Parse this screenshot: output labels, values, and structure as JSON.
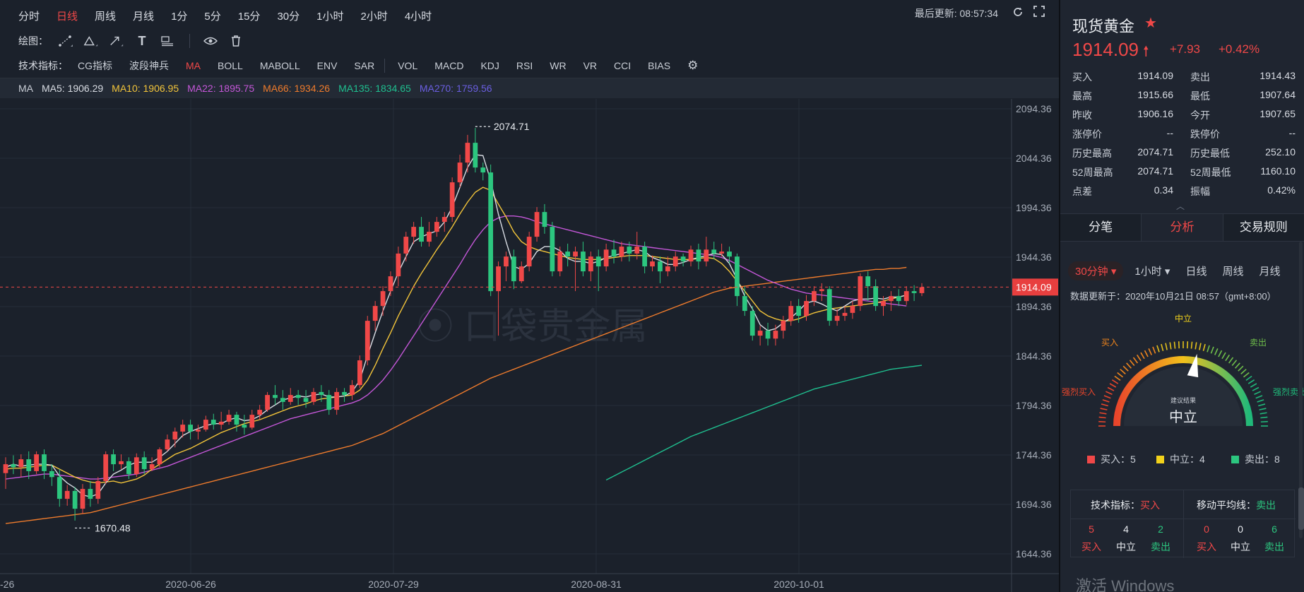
{
  "toolbar": {
    "periods": [
      {
        "label": "分时",
        "active": false
      },
      {
        "label": "日线",
        "active": true
      },
      {
        "label": "周线",
        "active": false
      },
      {
        "label": "月线",
        "active": false
      },
      {
        "label": "1分",
        "active": false
      },
      {
        "label": "5分",
        "active": false
      },
      {
        "label": "15分",
        "active": false
      },
      {
        "label": "30分",
        "active": false
      },
      {
        "label": "1小时",
        "active": false
      },
      {
        "label": "2小时",
        "active": false
      },
      {
        "label": "4小时",
        "active": false
      }
    ],
    "last_update": "最后更新: 08:57:34",
    "draw_label": "绘图：",
    "indicator_label": "技术指标：",
    "indicators_a": [
      "CG指标",
      "波段神兵",
      "MA",
      "BOLL",
      "MABOLL",
      "ENV",
      "SAR"
    ],
    "indicators_b": [
      "VOL",
      "MACD",
      "KDJ",
      "RSI",
      "WR",
      "VR",
      "CCI",
      "BIAS"
    ],
    "active_indicator": "MA"
  },
  "ma_bar": {
    "label": "MA",
    "items": [
      {
        "text": "MA5: 1906.29",
        "color": "#d8dce3"
      },
      {
        "text": "MA10: 1906.95",
        "color": "#f2c43a"
      },
      {
        "text": "MA22: 1895.75",
        "color": "#c457d8"
      },
      {
        "text": "MA66: 1934.26",
        "color": "#ee7b2c"
      },
      {
        "text": "MA135: 1834.65",
        "color": "#1fbf8f"
      },
      {
        "text": "MA270: 1759.56",
        "color": "#6a5ee0"
      }
    ]
  },
  "chart_data": {
    "type": "candlestick",
    "y_ticks": [
      "2094.36",
      "2044.36",
      "1994.36",
      "1944.36",
      "1894.36",
      "1844.36",
      "1794.36",
      "1744.36",
      "1694.36",
      "1644.36"
    ],
    "ylim": [
      1631,
      2107
    ],
    "x_ticks": [
      "-26",
      "2020-06-26",
      "2020-07-29",
      "2020-08-31",
      "2020-10-01"
    ],
    "current_price_label": "1914.09",
    "current_price": 1914.09,
    "high_annotation": "2074.71",
    "low_annotation": "1670.48",
    "colors": {
      "up": "#f04848",
      "down": "#2cc67f"
    },
    "candles": [
      [
        1726,
        1735,
        1710,
        1742
      ],
      [
        1735,
        1732,
        1725,
        1744
      ],
      [
        1732,
        1740,
        1722,
        1745
      ],
      [
        1740,
        1728,
        1720,
        1748
      ],
      [
        1728,
        1745,
        1725,
        1748
      ],
      [
        1745,
        1728,
        1720,
        1750
      ],
      [
        1728,
        1722,
        1713,
        1735
      ],
      [
        1722,
        1700,
        1692,
        1730
      ],
      [
        1700,
        1708,
        1693,
        1714
      ],
      [
        1708,
        1690,
        1678,
        1712
      ],
      [
        1690,
        1710,
        1685,
        1715
      ],
      [
        1710,
        1700,
        1692,
        1718
      ],
      [
        1700,
        1718,
        1695,
        1722
      ],
      [
        1718,
        1745,
        1715,
        1748
      ],
      [
        1745,
        1735,
        1728,
        1750
      ],
      [
        1735,
        1738,
        1730,
        1745
      ],
      [
        1738,
        1725,
        1720,
        1742
      ],
      [
        1725,
        1742,
        1722,
        1746
      ],
      [
        1742,
        1730,
        1725,
        1748
      ],
      [
        1730,
        1735,
        1728,
        1742
      ],
      [
        1735,
        1750,
        1732,
        1752
      ],
      [
        1750,
        1760,
        1748,
        1765
      ],
      [
        1760,
        1768,
        1752,
        1772
      ],
      [
        1768,
        1775,
        1762,
        1780
      ],
      [
        1775,
        1768,
        1760,
        1780
      ],
      [
        1768,
        1770,
        1760,
        1775
      ],
      [
        1770,
        1780,
        1768,
        1784
      ],
      [
        1780,
        1775,
        1770,
        1786
      ],
      [
        1775,
        1778,
        1770,
        1788
      ],
      [
        1778,
        1785,
        1775,
        1790
      ],
      [
        1785,
        1775,
        1768,
        1788
      ],
      [
        1775,
        1772,
        1765,
        1785
      ],
      [
        1772,
        1785,
        1770,
        1790
      ],
      [
        1785,
        1790,
        1780,
        1795
      ],
      [
        1790,
        1805,
        1788,
        1808
      ],
      [
        1805,
        1802,
        1795,
        1815
      ],
      [
        1802,
        1798,
        1790,
        1810
      ],
      [
        1798,
        1805,
        1795,
        1812
      ],
      [
        1805,
        1802,
        1795,
        1810
      ],
      [
        1802,
        1798,
        1792,
        1810
      ],
      [
        1798,
        1808,
        1795,
        1812
      ],
      [
        1808,
        1805,
        1798,
        1815
      ],
      [
        1805,
        1790,
        1785,
        1810
      ],
      [
        1790,
        1808,
        1785,
        1812
      ],
      [
        1808,
        1805,
        1798,
        1812
      ],
      [
        1805,
        1815,
        1800,
        1820
      ],
      [
        1815,
        1840,
        1812,
        1845
      ],
      [
        1840,
        1880,
        1835,
        1885
      ],
      [
        1880,
        1895,
        1870,
        1900
      ],
      [
        1895,
        1910,
        1885,
        1915
      ],
      [
        1910,
        1925,
        1905,
        1930
      ],
      [
        1925,
        1948,
        1915,
        1955
      ],
      [
        1948,
        1965,
        1940,
        1970
      ],
      [
        1965,
        1975,
        1958,
        1980
      ],
      [
        1975,
        1960,
        1955,
        1985
      ],
      [
        1960,
        1970,
        1955,
        1980
      ],
      [
        1970,
        1980,
        1965,
        1985
      ],
      [
        1980,
        1985,
        1970,
        1990
      ],
      [
        1985,
        2020,
        1980,
        2025
      ],
      [
        2020,
        2040,
        2015,
        2048
      ],
      [
        2040,
        2060,
        2030,
        2068
      ],
      [
        2060,
        2035,
        2030,
        2075
      ],
      [
        2035,
        2030,
        2022,
        2040
      ],
      [
        2030,
        1910,
        1905,
        2038
      ],
      [
        1910,
        1935,
        1865,
        1940
      ],
      [
        1935,
        1945,
        1920,
        1950
      ],
      [
        1945,
        1920,
        1912,
        1952
      ],
      [
        1920,
        1935,
        1918,
        1940
      ],
      [
        1935,
        1965,
        1930,
        1970
      ],
      [
        1965,
        1990,
        1960,
        1995
      ],
      [
        1990,
        1975,
        1968,
        1998
      ],
      [
        1975,
        1930,
        1925,
        1980
      ],
      [
        1930,
        1950,
        1925,
        1955
      ],
      [
        1950,
        1945,
        1935,
        1958
      ],
      [
        1945,
        1950,
        1910,
        1955
      ],
      [
        1950,
        1930,
        1925,
        1960
      ],
      [
        1930,
        1945,
        1920,
        1950
      ],
      [
        1945,
        1935,
        1910,
        1952
      ],
      [
        1935,
        1952,
        1930,
        1958
      ],
      [
        1952,
        1945,
        1938,
        1962
      ],
      [
        1945,
        1955,
        1940,
        1960
      ],
      [
        1955,
        1948,
        1940,
        1960
      ],
      [
        1948,
        1955,
        1942,
        1970
      ],
      [
        1955,
        1935,
        1928,
        1960
      ],
      [
        1935,
        1940,
        1930,
        1946
      ],
      [
        1940,
        1930,
        1918,
        1945
      ],
      [
        1930,
        1935,
        1925,
        1945
      ],
      [
        1935,
        1945,
        1930,
        1950
      ],
      [
        1945,
        1940,
        1935,
        1948
      ],
      [
        1940,
        1952,
        1935,
        1956
      ],
      [
        1952,
        1940,
        1932,
        1958
      ],
      [
        1940,
        1952,
        1935,
        1965
      ],
      [
        1952,
        1948,
        1942,
        1960
      ],
      [
        1948,
        1950,
        1945,
        1958
      ],
      [
        1950,
        1945,
        1938,
        1955
      ],
      [
        1945,
        1905,
        1895,
        1948
      ],
      [
        1905,
        1890,
        1885,
        1915
      ],
      [
        1890,
        1865,
        1860,
        1895
      ],
      [
        1865,
        1870,
        1855,
        1875
      ],
      [
        1870,
        1862,
        1855,
        1878
      ],
      [
        1862,
        1870,
        1855,
        1876
      ],
      [
        1870,
        1880,
        1862,
        1885
      ],
      [
        1880,
        1895,
        1875,
        1900
      ],
      [
        1895,
        1885,
        1878,
        1902
      ],
      [
        1885,
        1900,
        1880,
        1906
      ],
      [
        1900,
        1910,
        1895,
        1915
      ],
      [
        1910,
        1912,
        1900,
        1918
      ],
      [
        1912,
        1880,
        1875,
        1915
      ],
      [
        1880,
        1885,
        1875,
        1892
      ],
      [
        1885,
        1888,
        1880,
        1895
      ],
      [
        1888,
        1895,
        1882,
        1900
      ],
      [
        1895,
        1925,
        1890,
        1928
      ],
      [
        1925,
        1915,
        1900,
        1930
      ],
      [
        1915,
        1895,
        1890,
        1922
      ],
      [
        1895,
        1900,
        1885,
        1905
      ],
      [
        1900,
        1905,
        1890,
        1910
      ],
      [
        1905,
        1900,
        1895,
        1912
      ],
      [
        1900,
        1910,
        1896,
        1915
      ],
      [
        1910,
        1908,
        1900,
        1916
      ],
      [
        1908,
        1914,
        1905,
        1918
      ]
    ],
    "ma5": [
      1732,
      1735,
      1733,
      1734,
      1735,
      1735,
      1734,
      1723,
      1716,
      1711,
      1704,
      1702,
      1705,
      1716,
      1725,
      1729,
      1734,
      1737,
      1737,
      1737,
      1742,
      1748,
      1756,
      1764,
      1768,
      1771,
      1774,
      1776,
      1776,
      1780,
      1782,
      1779,
      1780,
      1784,
      1790,
      1795,
      1800,
      1802,
      1804,
      1803,
      1805,
      1806,
      1803,
      1803,
      1804,
      1808,
      1820,
      1845,
      1868,
      1890,
      1910,
      1929,
      1945,
      1960,
      1965,
      1968,
      1971,
      1980,
      1995,
      2015,
      2035,
      2048,
      2047,
      2022,
      1988,
      1960,
      1935,
      1932,
      1938,
      1950,
      1955,
      1955,
      1951,
      1943,
      1940,
      1940,
      1938,
      1940,
      1944,
      1946,
      1948,
      1950,
      1952,
      1950,
      1944,
      1941,
      1937,
      1937,
      1939,
      1942,
      1944,
      1946,
      1948,
      1947,
      1938,
      1922,
      1905,
      1892,
      1876,
      1870,
      1872,
      1878,
      1883,
      1890,
      1898,
      1900,
      1897,
      1893,
      1890,
      1895,
      1900,
      1902,
      1902,
      1903,
      1902,
      1904,
      1904,
      1906
    ],
    "ma10": [
      1730,
      1731,
      1731,
      1732,
      1733,
      1734,
      1734,
      1730,
      1726,
      1722,
      1719,
      1717,
      1716,
      1717,
      1718,
      1716,
      1718,
      1720,
      1724,
      1730,
      1735,
      1740,
      1745,
      1748,
      1751,
      1755,
      1759,
      1763,
      1767,
      1770,
      1773,
      1776,
      1778,
      1780,
      1783,
      1786,
      1789,
      1792,
      1794,
      1796,
      1799,
      1801,
      1802,
      1803,
      1804,
      1805,
      1810,
      1820,
      1835,
      1852,
      1868,
      1885,
      1900,
      1915,
      1928,
      1940,
      1952,
      1963,
      1975,
      1988,
      2000,
      2010,
      2015,
      2012,
      1998,
      1985,
      1970,
      1960,
      1955,
      1952,
      1950,
      1948,
      1946,
      1944,
      1943,
      1942,
      1942,
      1942,
      1943,
      1944,
      1945,
      1946,
      1946,
      1946,
      1945,
      1944,
      1943,
      1942,
      1942,
      1942,
      1943,
      1944,
      1943,
      1938,
      1930,
      1920,
      1910,
      1900,
      1890,
      1885,
      1882,
      1880,
      1880,
      1882,
      1885,
      1888,
      1890,
      1892,
      1893,
      1894,
      1895,
      1896,
      1897,
      1898,
      1900,
      1902,
      1904,
      1906
    ],
    "ma22": [
      1720,
      1721,
      1722,
      1723,
      1724,
      1725,
      1725,
      1724,
      1723,
      1722,
      1721,
      1720,
      1720,
      1721,
      1722,
      1723,
      1724,
      1725,
      1727,
      1729,
      1731,
      1733,
      1736,
      1739,
      1742,
      1745,
      1748,
      1751,
      1754,
      1757,
      1760,
      1763,
      1766,
      1769,
      1772,
      1775,
      1778,
      1781,
      1783,
      1785,
      1787,
      1789,
      1791,
      1793,
      1795,
      1797,
      1800,
      1805,
      1812,
      1820,
      1830,
      1841,
      1853,
      1865,
      1877,
      1889,
      1901,
      1913,
      1925,
      1937,
      1950,
      1962,
      1972,
      1980,
      1984,
      1986,
      1986,
      1985,
      1983,
      1980,
      1978,
      1976,
      1974,
      1972,
      1970,
      1968,
      1966,
      1964,
      1962,
      1960,
      1958,
      1957,
      1956,
      1955,
      1954,
      1953,
      1952,
      1951,
      1950,
      1949,
      1948,
      1947,
      1946,
      1944,
      1941,
      1937,
      1933,
      1929,
      1925,
      1921,
      1918,
      1915,
      1912,
      1910,
      1908,
      1907,
      1906,
      1905,
      1904,
      1903,
      1902,
      1901,
      1900,
      1899,
      1898,
      1897,
      1896,
      1895
    ],
    "ma66": [
      1675,
      1676,
      1677,
      1678,
      1679,
      1680,
      1681,
      1682,
      1683,
      1684,
      1685,
      1686,
      1688,
      1690,
      1692,
      1694,
      1696,
      1698,
      1700,
      1702,
      1704,
      1706,
      1708,
      1710,
      1712,
      1714,
      1716,
      1718,
      1720,
      1722,
      1724,
      1726,
      1728,
      1730,
      1732,
      1734,
      1736,
      1738,
      1740,
      1742,
      1744,
      1746,
      1748,
      1750,
      1752,
      1754,
      1757,
      1760,
      1763,
      1766,
      1770,
      1774,
      1778,
      1782,
      1786,
      1790,
      1794,
      1798,
      1802,
      1806,
      1810,
      1814,
      1818,
      1822,
      1825,
      1828,
      1831,
      1834,
      1837,
      1840,
      1843,
      1846,
      1849,
      1852,
      1855,
      1858,
      1861,
      1864,
      1867,
      1870,
      1873,
      1876,
      1879,
      1882,
      1885,
      1888,
      1891,
      1894,
      1897,
      1900,
      1903,
      1906,
      1909,
      1911,
      1913,
      1914,
      1915,
      1916,
      1917,
      1918,
      1919,
      1920,
      1921,
      1922,
      1923,
      1924,
      1925,
      1926,
      1927,
      1928,
      1929,
      1930,
      1931,
      1932,
      1932,
      1933,
      1933,
      1934
    ],
    "ma135": [
      1719,
      1723,
      1727,
      1731,
      1735,
      1739,
      1743,
      1747,
      1751,
      1755,
      1759,
      1763,
      1766,
      1769,
      1772,
      1775,
      1778,
      1781,
      1784,
      1787,
      1790,
      1793,
      1796,
      1799,
      1802,
      1805,
      1808,
      1811,
      1813,
      1815,
      1817,
      1819,
      1821,
      1823,
      1825,
      1827,
      1829,
      1831,
      1832,
      1833,
      1834,
      1835
    ]
  },
  "panel": {
    "title": "现货黄金",
    "price": "1914.09",
    "change": "+7.93",
    "change_pct": "+0.42%",
    "quote_rows": [
      [
        "买入",
        "1914.09",
        "卖出",
        "1914.43"
      ],
      [
        "最高",
        "1915.66",
        "最低",
        "1907.64"
      ],
      [
        "昨收",
        "1906.16",
        "今开",
        "1907.65"
      ],
      [
        "涨停价",
        "--",
        "跌停价",
        "--"
      ],
      [
        "历史最高",
        "2074.71",
        "历史最低",
        "252.10"
      ],
      [
        "52周最高",
        "2074.71",
        "52周最低",
        "1160.10"
      ],
      [
        "点差",
        "0.34",
        "振幅",
        "0.42%"
      ]
    ],
    "tabs": [
      {
        "label": "分笔",
        "active": false
      },
      {
        "label": "分析",
        "active": true
      },
      {
        "label": "交易规则",
        "active": false
      }
    ],
    "period_tabs": [
      {
        "label": "30分钟 ▾",
        "active": true
      },
      {
        "label": "1小时 ▾",
        "active": false
      },
      {
        "label": "日线",
        "active": false
      },
      {
        "label": "周线",
        "active": false
      },
      {
        "label": "月线",
        "active": false
      }
    ],
    "update_text": "数据更新于：2020年10月21日 08:57（gmt+8:00）",
    "gauge": {
      "top_label": "中立",
      "buy_label": "买入",
      "sell_label": "卖出",
      "strong_buy_label": "强烈买入",
      "strong_sell_label": "强烈卖出",
      "center_small": "建议结果",
      "center_big": "中立",
      "needle_fraction": 0.56
    },
    "legend": [
      {
        "text": "买入：5",
        "color": "#f04848"
      },
      {
        "text": "中立：4",
        "color": "#f2d21b"
      },
      {
        "text": "卖出：8",
        "color": "#2cc67f"
      }
    ],
    "summary": {
      "left_label": "技术指标：",
      "left_value": "买入",
      "right_label": "移动平均线：",
      "right_value": "卖出",
      "left_counts": [
        "5",
        "4",
        "2"
      ],
      "right_counts": [
        "0",
        "0",
        "6"
      ],
      "count_labels": [
        "买入",
        "中立",
        "卖出"
      ]
    },
    "watermark": "激活 Windows"
  }
}
